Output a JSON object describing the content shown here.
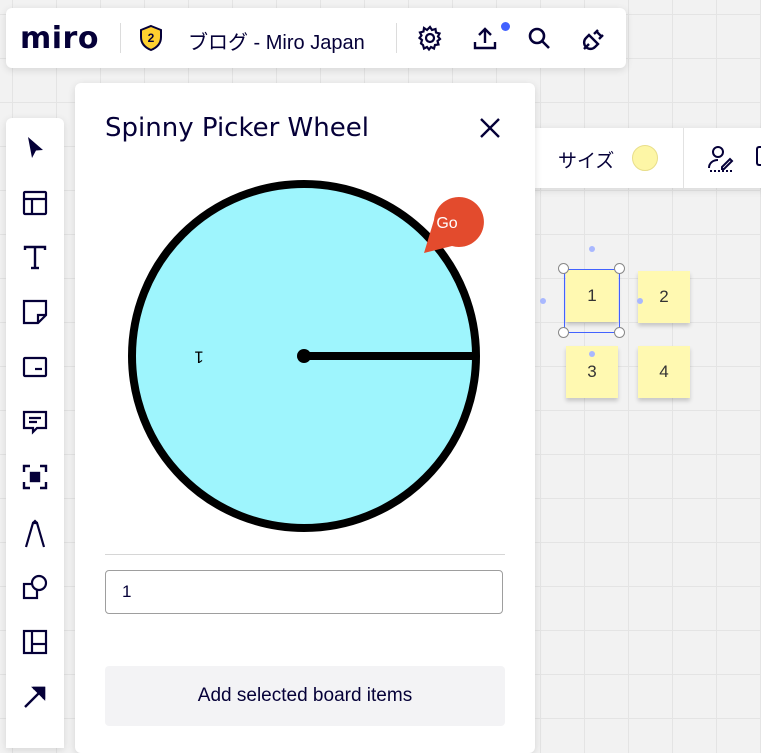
{
  "topbar": {
    "logo": "miro",
    "plan_badge": "2",
    "board_title": "ブログ - Miro Japan",
    "icons": [
      "shield-badge-icon",
      "gear-icon",
      "upload-icon",
      "search-icon",
      "plug-icon"
    ],
    "notification_dot_color": "#4262ff"
  },
  "toolbar": {
    "tools": [
      "cursor-icon",
      "template-icon",
      "text-icon",
      "sticky-note-icon",
      "card-icon",
      "comment-icon",
      "frame-icon",
      "pen-icon",
      "shapes-icon",
      "kanban-icon",
      "arrow-icon"
    ]
  },
  "context_bar": {
    "size_label": "サイズ",
    "swatch_color": "#fdf6a6"
  },
  "picker": {
    "title": "Spinny Picker Wheel",
    "go_label": "Go",
    "wheel_color": "#9ef5fd",
    "go_color": "#e34b2d",
    "wheel_segments": [
      "1"
    ],
    "input_value": "1",
    "add_button_label": "Add selected board items"
  },
  "board": {
    "sticky_color": "#fff9b1",
    "stickies": [
      "1",
      "2",
      "3",
      "4"
    ]
  }
}
